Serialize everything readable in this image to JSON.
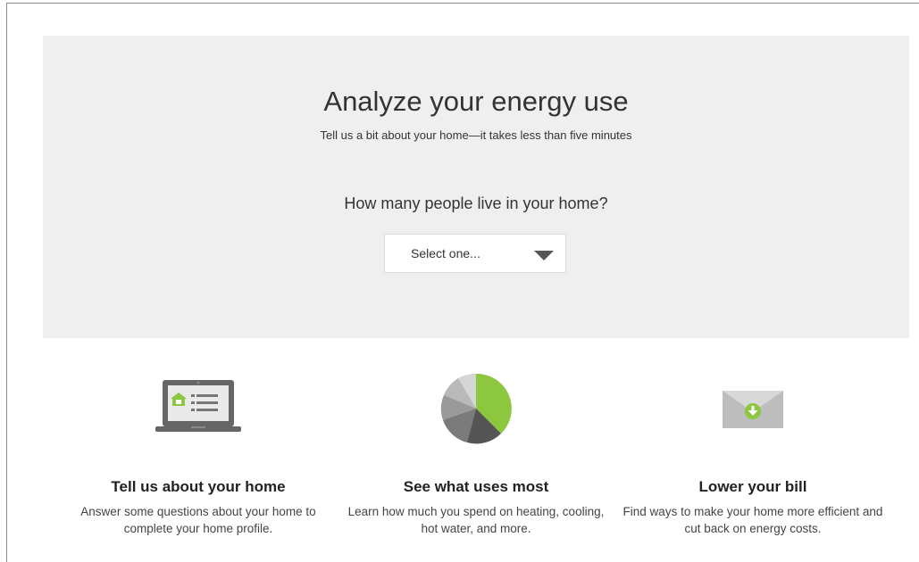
{
  "hero": {
    "title": "Analyze your energy use",
    "subtitle": "Tell us a bit about your home—it takes less than five minutes",
    "question": "How many people live in your home?",
    "select": {
      "value": "Select one..."
    }
  },
  "features": [
    {
      "icon": "laptop-home-profile-icon",
      "title": "Tell us about your home",
      "description": "Answer some questions about your home to complete your home profile."
    },
    {
      "icon": "pie-chart-icon",
      "title": "See what uses most",
      "description": "Learn how much you spend on heating, cooling, hot water, and more."
    },
    {
      "icon": "envelope-download-icon",
      "title": "Lower your bill",
      "description": "Find ways to make your home more efficient and cut back on energy costs."
    }
  ],
  "colors": {
    "accent_green": "#8dc63f",
    "hero_background": "#efefef"
  }
}
